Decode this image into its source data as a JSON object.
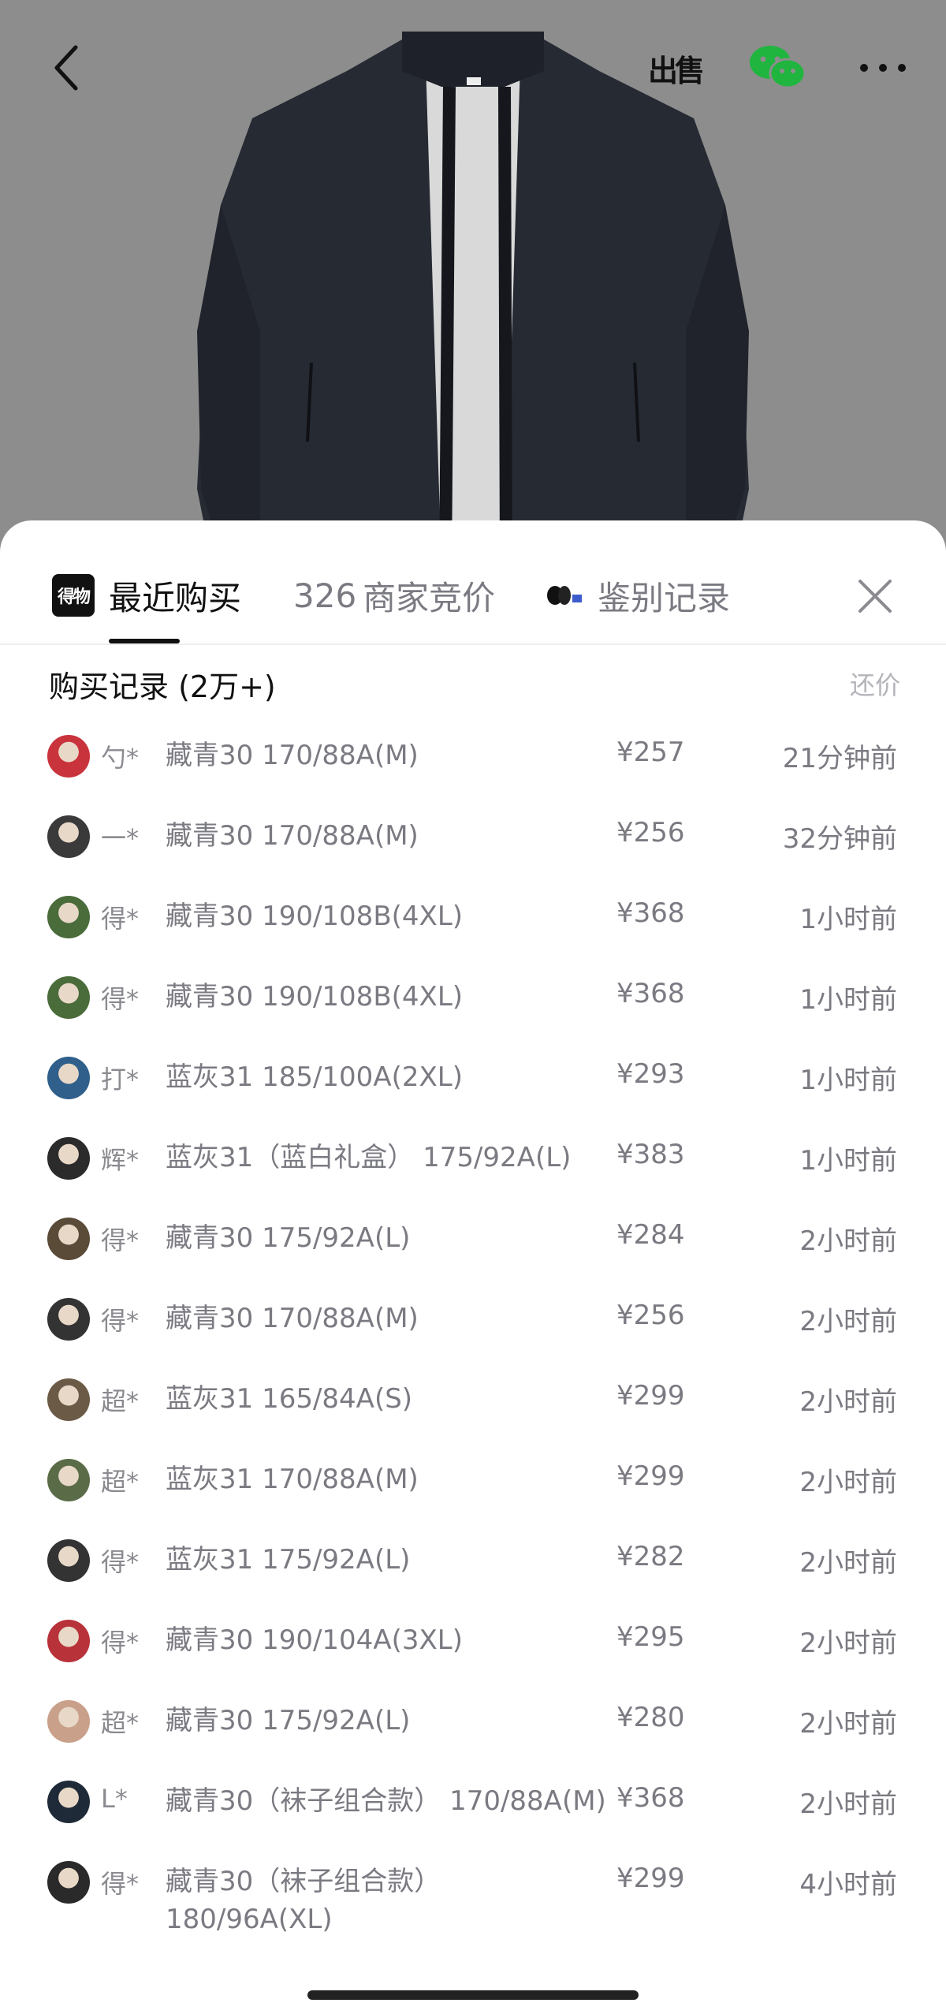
{
  "topbar": {
    "sell_label": "出售",
    "icons": [
      "back-icon",
      "sell-icon",
      "wechat-icon",
      "more-icon"
    ]
  },
  "tabs": [
    {
      "label": "最近购买",
      "logo": "得物",
      "active": true
    },
    {
      "number": "326",
      "label": "商家竞价",
      "active": false
    },
    {
      "label": "鉴别记录",
      "icon": "authentication-icon",
      "active": false
    }
  ],
  "records": {
    "title": "购买记录 (2万+)",
    "bargain_label": "还价",
    "rows": [
      {
        "user": "勺*",
        "spec": "藏青30 170/88A(M)",
        "price": "¥257",
        "time": "21分钟前",
        "avatar_color": "#c9333b"
      },
      {
        "user": "一*",
        "spec": "藏青30 170/88A(M)",
        "price": "¥256",
        "time": "32分钟前",
        "avatar_color": "#3a3a3a"
      },
      {
        "user": "得*",
        "spec": "藏青30 190/108B(4XL)",
        "price": "¥368",
        "time": "1小时前",
        "avatar_color": "#4a6b3a"
      },
      {
        "user": "得*",
        "spec": "藏青30 190/108B(4XL)",
        "price": "¥368",
        "time": "1小时前",
        "avatar_color": "#4a6b3a"
      },
      {
        "user": "打*",
        "spec": "蓝灰31 185/100A(2XL)",
        "price": "¥293",
        "time": "1小时前",
        "avatar_color": "#2f5f8a"
      },
      {
        "user": "辉*",
        "spec": "蓝灰31（蓝白礼盒） 175/92A(L)",
        "price": "¥383",
        "time": "1小时前",
        "avatar_color": "#2b2b2b"
      },
      {
        "user": "得*",
        "spec": "藏青30 175/92A(L)",
        "price": "¥284",
        "time": "2小时前",
        "avatar_color": "#5a4a38"
      },
      {
        "user": "得*",
        "spec": "藏青30 170/88A(M)",
        "price": "¥256",
        "time": "2小时前",
        "avatar_color": "#333333"
      },
      {
        "user": "超*",
        "spec": "蓝灰31 165/84A(S)",
        "price": "¥299",
        "time": "2小时前",
        "avatar_color": "#6b5a46"
      },
      {
        "user": "超*",
        "spec": "蓝灰31 170/88A(M)",
        "price": "¥299",
        "time": "2小时前",
        "avatar_color": "#5a6b48"
      },
      {
        "user": "得*",
        "spec": "蓝灰31 175/92A(L)",
        "price": "¥282",
        "time": "2小时前",
        "avatar_color": "#333333"
      },
      {
        "user": "得*",
        "spec": "藏青30 190/104A(3XL)",
        "price": "¥295",
        "time": "2小时前",
        "avatar_color": "#b8323a"
      },
      {
        "user": "超*",
        "spec": "藏青30 175/92A(L)",
        "price": "¥280",
        "time": "2小时前",
        "avatar_color": "#c9a08a"
      },
      {
        "user": "L*",
        "spec": "藏青30（袜子组合款） 170/88A(M)",
        "price": "¥368",
        "time": "2小时前",
        "avatar_color": "#1f2a38"
      },
      {
        "user": "得*",
        "spec": "藏青30（袜子组合款） 180/96A(XL)",
        "price": "¥299",
        "time": "4小时前",
        "avatar_color": "#2a2a2a"
      }
    ]
  }
}
